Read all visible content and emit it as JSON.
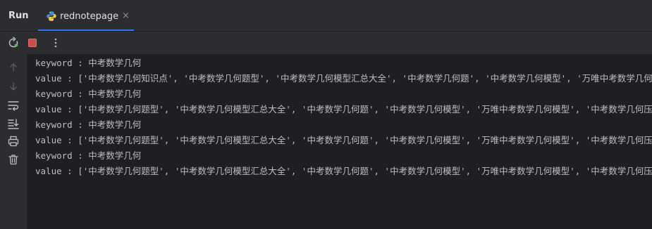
{
  "toolwindow": {
    "title": "Run",
    "tab_label": "rednotepage",
    "tab_close": "×"
  },
  "console": {
    "lines": [
      "keyword : 中考数学几何",
      "value : ['中考数学几何知识点', '中考数学几何题型', '中考数学几何模型汇总大全', '中考数学几何题', '中考数学几何模型', '万唯中考数学几何模型'",
      "keyword : 中考数学几何",
      "value : ['中考数学几何题型', '中考数学几何模型汇总大全', '中考数学几何题', '中考数学几何模型', '万唯中考数学几何模型', '中考数学几何压轴题'",
      "keyword : 中考数学几何",
      "value : ['中考数学几何题型', '中考数学几何模型汇总大全', '中考数学几何题', '中考数学几何模型', '万唯中考数学几何模型', '中考数学几何压轴题'",
      "keyword : 中考数学几何",
      "value : ['中考数学几何题型', '中考数学几何模型汇总大全', '中考数学几何题', '中考数学几何模型', '万唯中考数学几何模型', '中考数学几何压轴题'"
    ]
  },
  "colors": {
    "background": "#1e1f22",
    "panel": "#2b2d30",
    "text": "#bcbec4",
    "accent": "#3574f0",
    "stop": "#c94f4f",
    "rerun": "#5fb865"
  },
  "icons": [
    "python-file-icon",
    "rerun-icon",
    "stop-icon",
    "more-icon",
    "scroll-up-icon",
    "scroll-down-icon",
    "soft-wrap-icon",
    "scroll-to-end-icon",
    "print-icon",
    "trash-icon"
  ]
}
